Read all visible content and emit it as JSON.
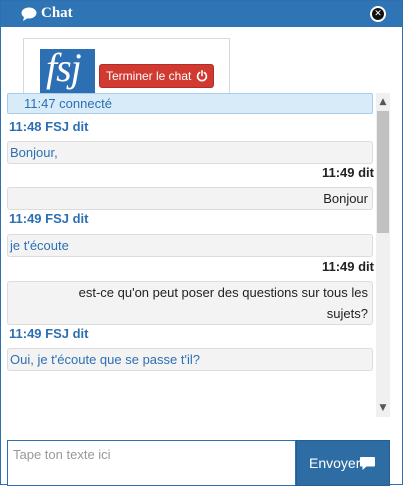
{
  "window": {
    "title": "Chat",
    "title_icon": "comment-icon",
    "close_icon": "close-icon",
    "accent_color": "#2f75b5"
  },
  "header": {
    "logo_text": "fsj",
    "end_chat_label": "Terminer le chat",
    "end_chat_icon": "power-icon",
    "end_chat_color": "#d03a31"
  },
  "status": {
    "text": "11:47 connecté"
  },
  "messages": [
    {
      "role": "agent",
      "sender": "11:48 FSJ dit",
      "text": "Bonjour,"
    },
    {
      "role": "user",
      "sender": "11:49 dit",
      "text": "Bonjour"
    },
    {
      "role": "agent",
      "sender": "11:49 FSJ dit",
      "text": "je t'écoute"
    },
    {
      "role": "user",
      "sender": "11:49 dit",
      "text": "est-ce qu'on peut poser des questions sur tous les sujets?"
    },
    {
      "role": "agent",
      "sender": "11:49 FSJ dit",
      "text": "Oui, je t'écoute que se passe t'il?"
    }
  ],
  "composer": {
    "placeholder": "Tape ton texte ici",
    "value": "",
    "send_label": "Envoyer",
    "send_icon": "comment-icon"
  }
}
